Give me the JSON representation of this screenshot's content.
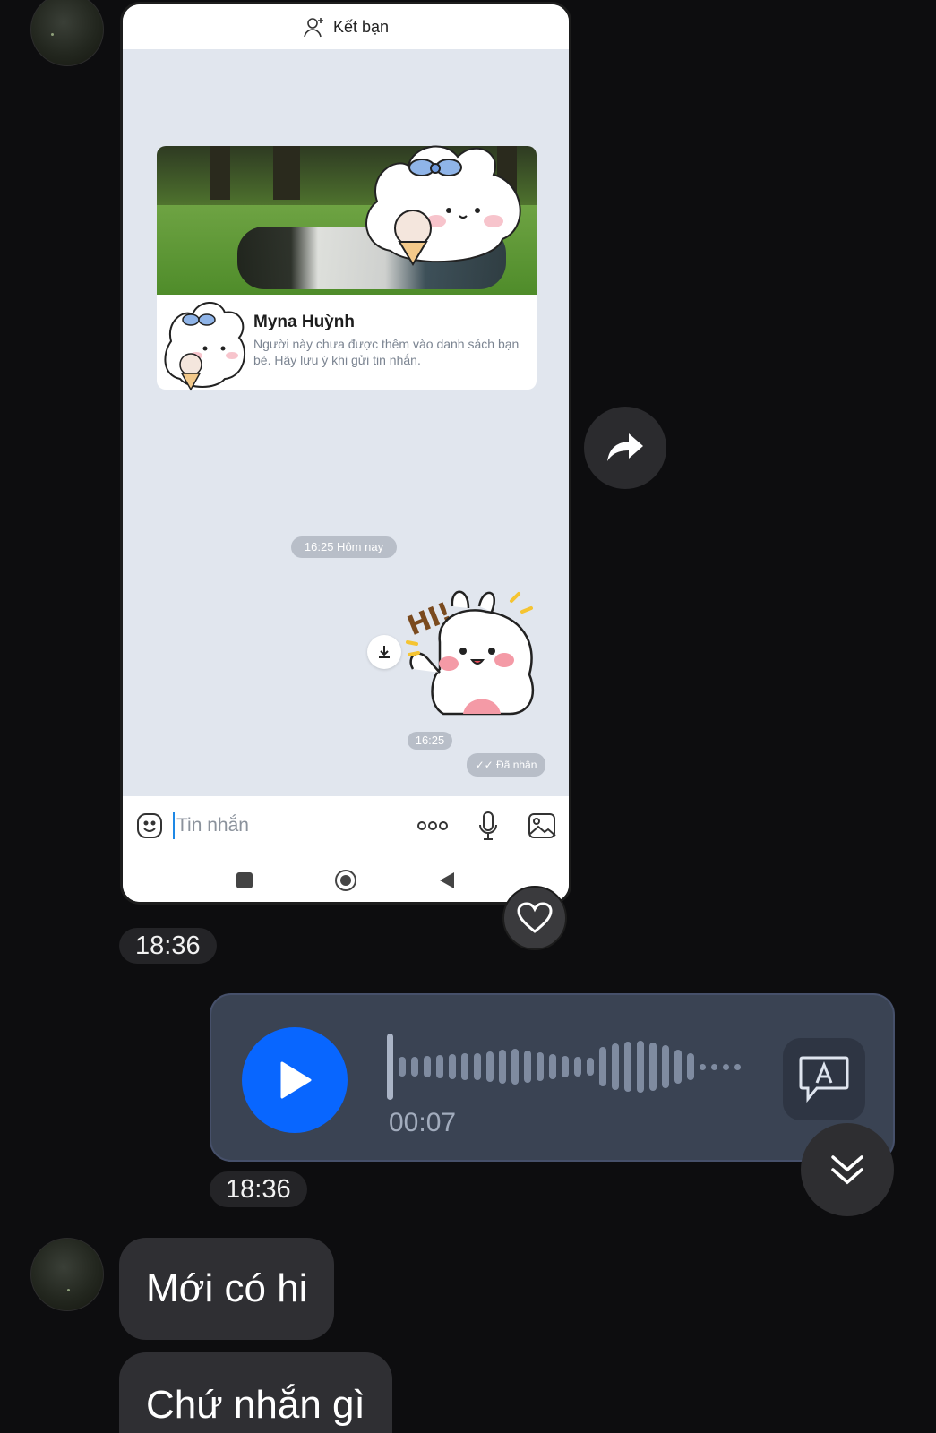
{
  "contact_avatars": [
    "avatar-icon",
    "avatar-icon"
  ],
  "screenshot": {
    "top_bar": {
      "icon": "add-friend-icon",
      "label": "Kết bạn"
    },
    "profile": {
      "name": "Myna Huỳnh",
      "note": "Người này chưa được thêm vào danh sách bạn bè. Hãy lưu ý khi gửi tin nhắn."
    },
    "time_divider": "16:25 Hôm nay",
    "sticker_time": "16:25",
    "sticker_text": "HI!",
    "status": "Đã nhận",
    "compose_placeholder": "Tin nhắn",
    "icons": [
      "emoji-icon",
      "more-icon",
      "microphone-icon",
      "image-icon",
      "download-icon"
    ],
    "nav_icons": [
      "recent-apps-icon",
      "home-icon",
      "back-icon"
    ]
  },
  "messages": [
    {
      "type": "image",
      "time": "18:36",
      "reaction": "heart-icon"
    },
    {
      "type": "voice",
      "duration": "00:07",
      "time": "18:36",
      "progress": 0
    },
    {
      "type": "text",
      "text": "Mới có hi"
    },
    {
      "type": "text",
      "text": "Chứ nhắn gì"
    }
  ],
  "actions": {
    "share": "share-icon",
    "scroll_down": "chevrons-down-icon",
    "transcribe": "transcribe-icon"
  },
  "colors": {
    "background": "#0d0d0f",
    "play_button": "#0866ff",
    "voice_bubble": "#3a4353",
    "bubble": "#2f2f33"
  }
}
